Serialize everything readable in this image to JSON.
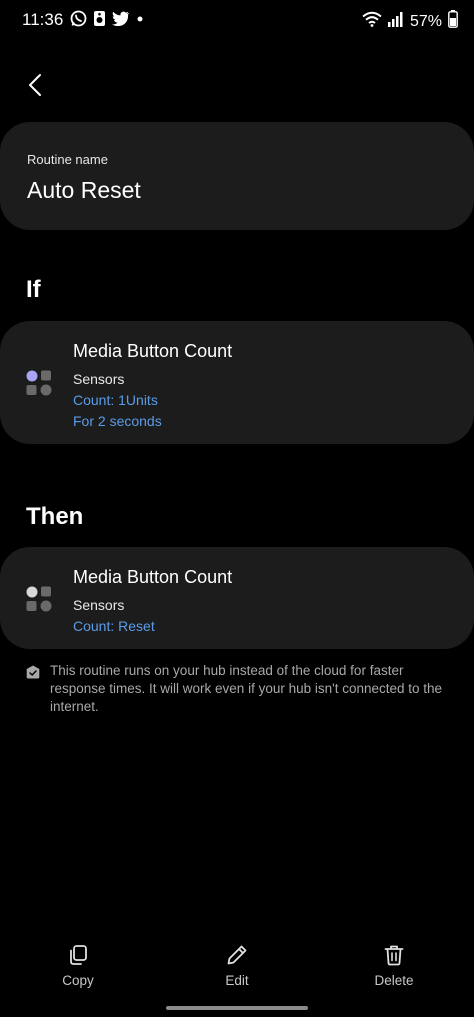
{
  "status_bar": {
    "time": "11:36",
    "battery": "57%",
    "icons": [
      "whatsapp-icon",
      "speaker-icon",
      "twitter-icon",
      "dot-icon",
      "wifi-icon",
      "signal-icon",
      "battery-icon"
    ]
  },
  "routine": {
    "name_label": "Routine name",
    "name_value": "Auto Reset"
  },
  "if_section": {
    "title": "If",
    "device": {
      "name": "Media Button Count",
      "type": "Sensors",
      "details": [
        "Count: 1Units",
        "For 2 seconds"
      ]
    }
  },
  "then_section": {
    "title": "Then",
    "device": {
      "name": "Media Button Count",
      "type": "Sensors",
      "details": [
        "Count: Reset"
      ]
    }
  },
  "info_note": "This routine runs on your hub instead of the cloud for faster response times. It will work even if your hub isn't connected to the internet.",
  "toolbar": {
    "copy_label": "Copy",
    "edit_label": "Edit",
    "delete_label": "Delete"
  },
  "colors": {
    "background": "#000000",
    "card": "#1c1c1c",
    "accent_blue": "#5b9ce8",
    "icon_purple": "#a9a4f5"
  }
}
